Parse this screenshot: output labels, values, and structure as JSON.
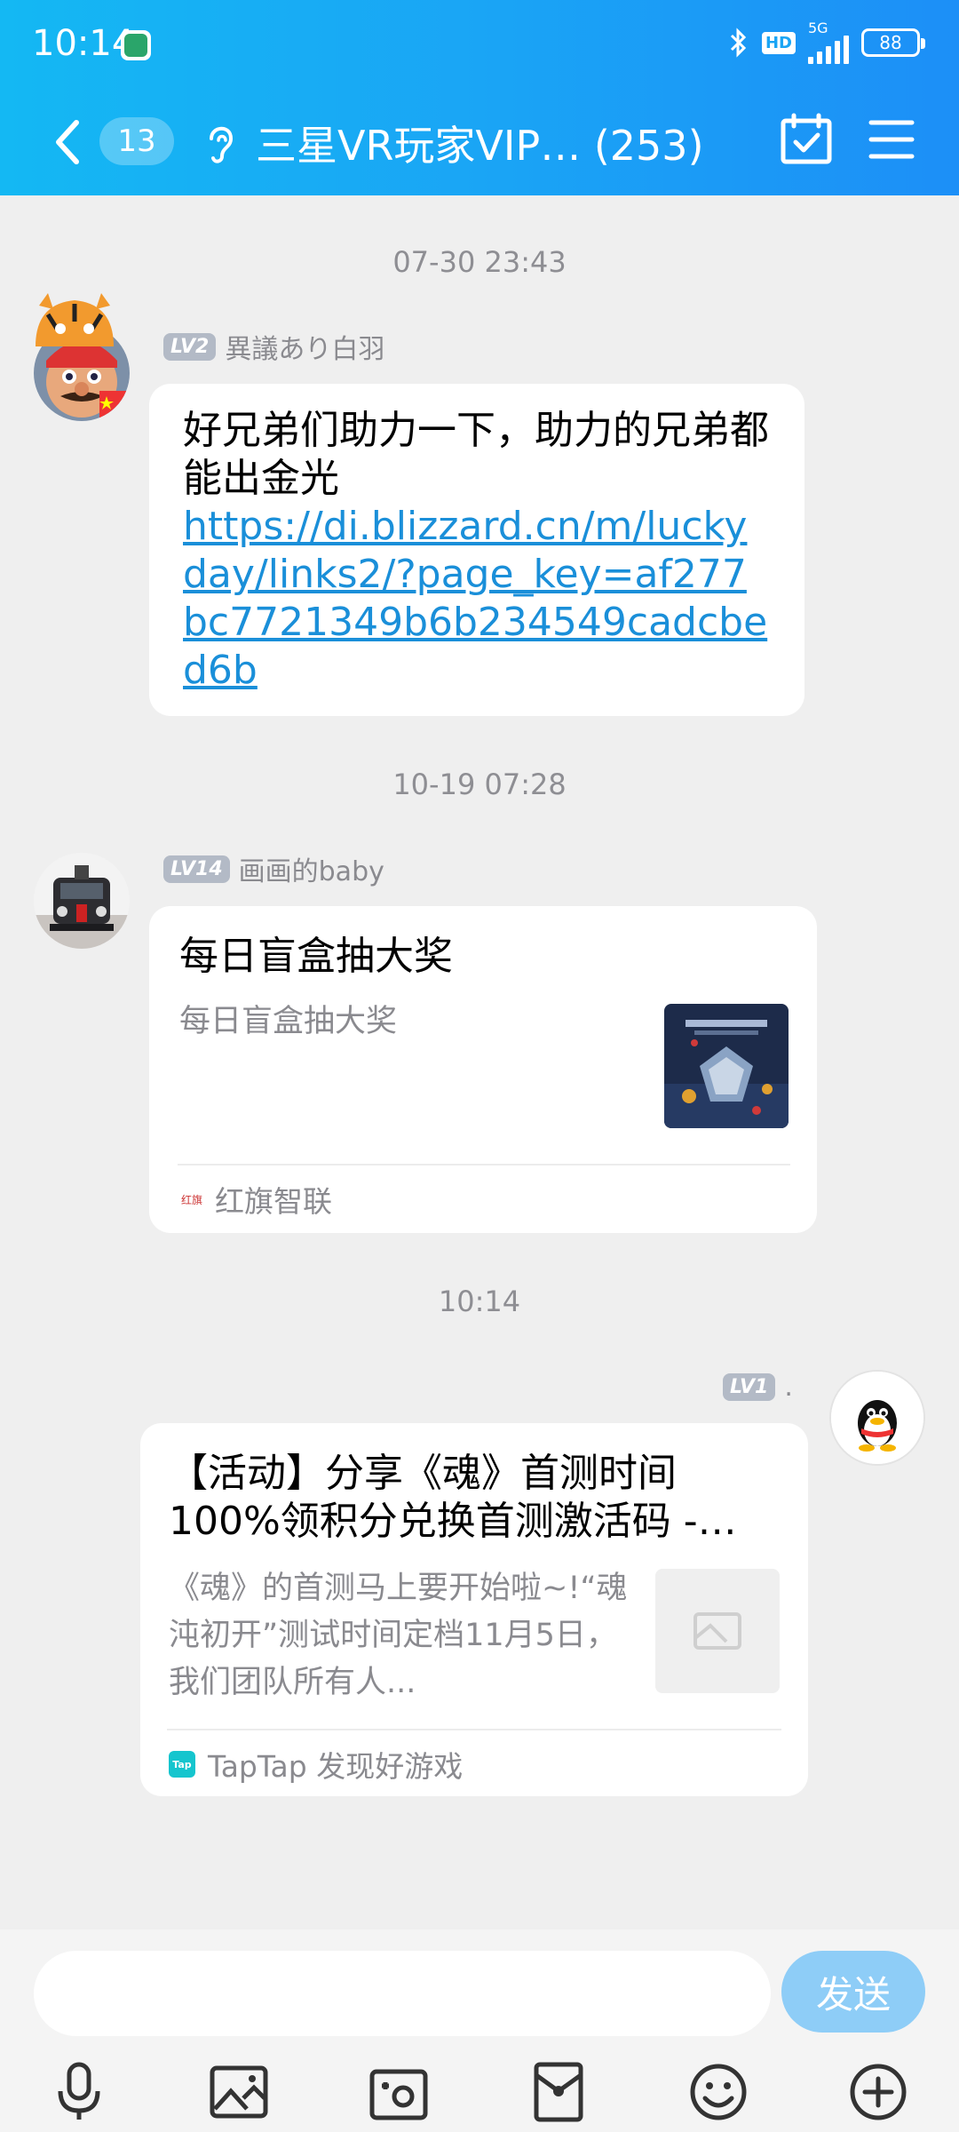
{
  "status_bar": {
    "time": "10:14",
    "network": "5G",
    "hd": "HD",
    "battery": "88"
  },
  "header": {
    "unread_count": "13",
    "title": "三星VR玩家VIP… (253)"
  },
  "messages": [
    {
      "timestamp": "07-30 23:43",
      "sender": {
        "level": "LV2",
        "name": "異議あり白羽"
      },
      "text": "好兄弟们助力一下，助力的兄弟都能出金光",
      "link": "https://di.blizzard.cn/m/luckyday/links2/?page_key=af277bc7721349b6b234549cadcbed6b"
    },
    {
      "timestamp": "10-19 07:28",
      "sender": {
        "level": "LV14",
        "name": "画画的baby"
      },
      "card": {
        "title": "每日盲盒抽大奖",
        "description": "每日盲盒抽大奖",
        "source": "红旗智联"
      }
    },
    {
      "timestamp": "10:14",
      "sender": {
        "level": "LV1",
        "name": "."
      },
      "card": {
        "title": "【活动】分享《魂》首测时间100%领积分兑换首测激活码 -…",
        "description": "《魂》的首测马上要开始啦~!“魂沌初开”测试时间定档11月5日，我们团队所有人...",
        "source": "TapTap 发现好游戏",
        "source_icon_text": "Tap"
      }
    }
  ],
  "input": {
    "send_label": "发送"
  },
  "colors": {
    "header_start": "#14b8f3",
    "header_end": "#1c8ff7",
    "link": "#1a8fd9",
    "send_button": "#8ecdf7"
  }
}
